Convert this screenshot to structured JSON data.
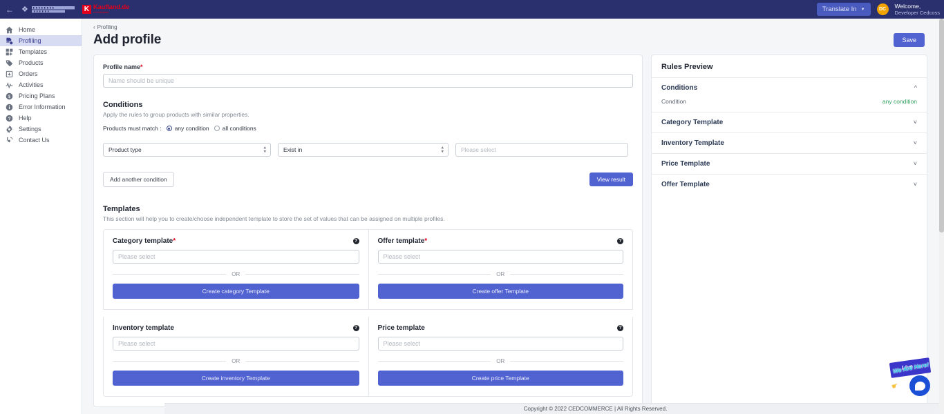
{
  "topbar": {
    "back_icon": "arrow-left-icon",
    "brand_primary": "CEDCOMMERCE",
    "brand_partner": "Kaufland.de",
    "brand_partner_sub": "ein Marktplatz",
    "translate_label": "Translate In",
    "avatar_initials": "DC",
    "welcome_line1": "Welcome,",
    "welcome_line2": "Developer Cedcoss"
  },
  "sidebar": {
    "items": [
      {
        "label": "Home",
        "icon": "home-icon",
        "active": false
      },
      {
        "label": "Profiling",
        "icon": "profiling-icon",
        "active": true
      },
      {
        "label": "Templates",
        "icon": "templates-icon",
        "active": false
      },
      {
        "label": "Products",
        "icon": "tag-icon",
        "active": false
      },
      {
        "label": "Orders",
        "icon": "orders-box-icon",
        "active": false
      },
      {
        "label": "Activities",
        "icon": "activity-pulse-icon",
        "active": false
      },
      {
        "label": "Pricing Plans",
        "icon": "dollar-circle-icon",
        "active": false
      },
      {
        "label": "Error Information",
        "icon": "info-circle-icon",
        "active": false
      },
      {
        "label": "Help",
        "icon": "question-circle-icon",
        "active": false
      },
      {
        "label": "Settings",
        "icon": "gear-icon",
        "active": false
      },
      {
        "label": "Contact Us",
        "icon": "phone-icon",
        "active": false
      }
    ]
  },
  "page": {
    "breadcrumb": "Profiling",
    "title": "Add profile",
    "save_label": "Save"
  },
  "profile_name": {
    "label": "Profile name",
    "required_marker": "*",
    "placeholder": "Name should be unique",
    "value": ""
  },
  "conditions": {
    "title": "Conditions",
    "subtitle": "Apply the rules to group products with similar properties.",
    "match_label": "Products must match :",
    "options": [
      {
        "label": "any condition",
        "selected": true
      },
      {
        "label": "all conditions",
        "selected": false
      }
    ],
    "row": {
      "attribute": "Product type",
      "operator": "Exist in",
      "value_placeholder": "Please select",
      "value": ""
    },
    "add_label": "Add another condition",
    "view_result_label": "View result"
  },
  "templates": {
    "title": "Templates",
    "subtitle": "This section will help you to create/choose independent template to store the set of values that can be assigned on multiple profiles.",
    "cells": [
      {
        "title": "Category template",
        "required_marker": "*",
        "placeholder": "Please select",
        "value": "",
        "or_label": "OR",
        "create_label": "Create category Template",
        "help_icon": "help-circle-icon"
      },
      {
        "title": "Offer template",
        "required_marker": "*",
        "placeholder": "Please select",
        "value": "",
        "or_label": "OR",
        "create_label": "Create offer Template",
        "help_icon": "help-circle-icon"
      },
      {
        "title": "Inventory template",
        "required_marker": "",
        "placeholder": "Please select",
        "value": "",
        "or_label": "OR",
        "create_label": "Create inventory Template",
        "help_icon": "help-circle-icon"
      },
      {
        "title": "Price template",
        "required_marker": "",
        "placeholder": "Please select",
        "value": "",
        "or_label": "OR",
        "create_label": "Create price Template",
        "help_icon": "help-circle-icon"
      }
    ]
  },
  "rules_preview": {
    "title": "Rules Preview",
    "conditions_section": {
      "label": "Conditions",
      "chevron": "chevron-up-icon",
      "row_key": "Condition",
      "row_value": "any condition",
      "value_color": "#2f9e5e"
    },
    "sections": [
      {
        "label": "Category Template",
        "chevron": "chevron-down-icon"
      },
      {
        "label": "Inventory Template",
        "chevron": "chevron-down-icon"
      },
      {
        "label": "Price Template",
        "chevron": "chevron-down-icon"
      },
      {
        "label": "Offer Template",
        "chevron": "chevron-down-icon"
      }
    ]
  },
  "footer": {
    "text": "Copyright © 2022 CEDCOMMERCE | All Rights Reserved."
  },
  "chat_widget": {
    "ribbon": "We Are Here!",
    "live": "Live",
    "icon": "chat-bubble-icon"
  }
}
